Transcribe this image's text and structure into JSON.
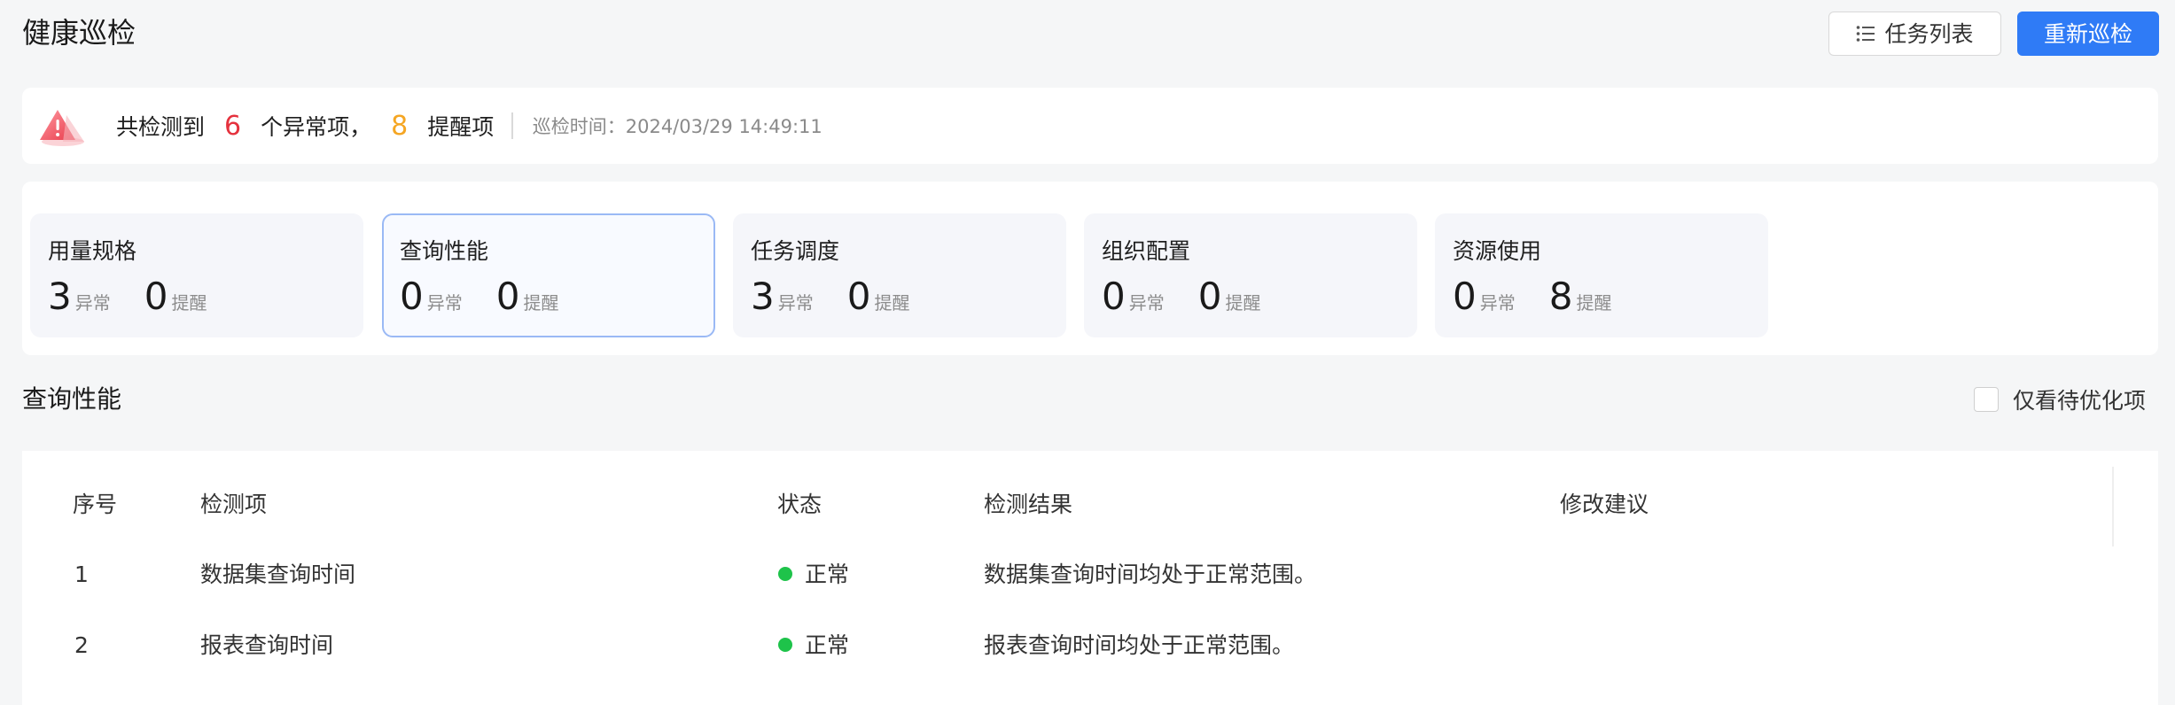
{
  "header": {
    "title": "健康巡检",
    "task_list_label": "任务列表",
    "recheck_label": "重新巡检"
  },
  "summary": {
    "prefix": "共检测到",
    "abnormal_count": "6",
    "abnormal_suffix": "个异常项，",
    "reminder_count": "8",
    "reminder_suffix": "提醒项",
    "time_label": "巡检时间：2024/03/29 14:49:11"
  },
  "categories": [
    {
      "title": "用量规格",
      "abnormal": "3",
      "abnormal_label": "异常",
      "reminder": "0",
      "reminder_label": "提醒"
    },
    {
      "title": "查询性能",
      "abnormal": "0",
      "abnormal_label": "异常",
      "reminder": "0",
      "reminder_label": "提醒"
    },
    {
      "title": "任务调度",
      "abnormal": "3",
      "abnormal_label": "异常",
      "reminder": "0",
      "reminder_label": "提醒"
    },
    {
      "title": "组织配置",
      "abnormal": "0",
      "abnormal_label": "异常",
      "reminder": "0",
      "reminder_label": "提醒"
    },
    {
      "title": "资源使用",
      "abnormal": "0",
      "abnormal_label": "异常",
      "reminder": "8",
      "reminder_label": "提醒"
    }
  ],
  "section": {
    "title": "查询性能",
    "filter_label": "仅看待优化项"
  },
  "table": {
    "headers": [
      "序号",
      "检测项",
      "状态",
      "检测结果",
      "修改建议"
    ],
    "rows": [
      {
        "index": "1",
        "item": "数据集查询时间",
        "status": "正常",
        "result": "数据集查询时间均处于正常范围。",
        "suggestion": ""
      },
      {
        "index": "2",
        "item": "报表查询时间",
        "status": "正常",
        "result": "报表查询时间均处于正常范围。",
        "suggestion": ""
      }
    ]
  },
  "colors": {
    "primary": "#2f7bf6",
    "abnormal": "#e5323e",
    "reminder": "#f5a623",
    "status_ok": "#1ec34a"
  },
  "icons": {
    "warning": "warning-triangle-icon",
    "list": "list-icon"
  }
}
